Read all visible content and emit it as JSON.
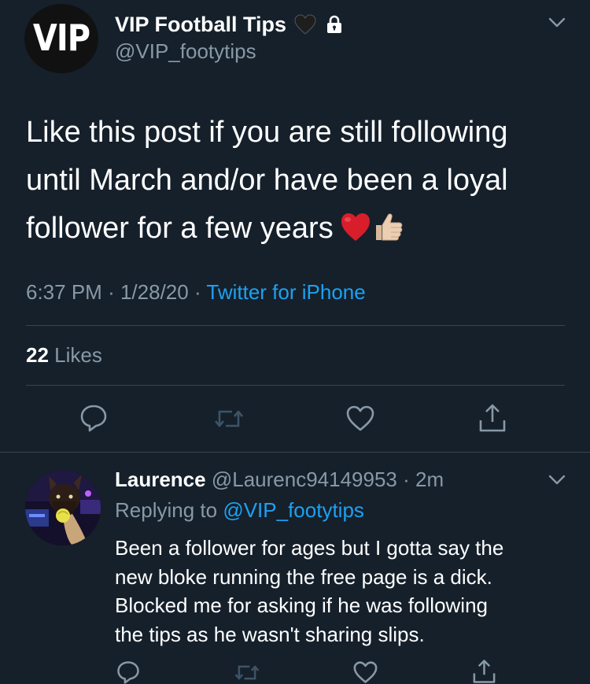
{
  "tweet": {
    "avatar_text": "VIP",
    "display_name": "VIP Football Tips",
    "handle": "@VIP_footytips",
    "text_lines": [
      "Like this post if you are still following",
      "until March and/or have been a loyal",
      "follower for a few years"
    ],
    "time": "6:37 PM",
    "date": "1/28/20",
    "source": "Twitter for iPhone",
    "likes_count": "22",
    "likes_label": "Likes",
    "separator": "·"
  },
  "reply": {
    "display_name": "Laurence",
    "handle": "@Laurenc94149953",
    "age": "2m",
    "replying_prefix": "Replying to",
    "replying_to": "@VIP_footytips",
    "text_lines": [
      "Been a follower for ages but I gotta say the",
      "new bloke running the free page is a dick.",
      "Blocked me for asking if he was following",
      "the tips as he wasn't sharing slips."
    ]
  },
  "icons": {
    "name_badge_1": "black-heart-emoji",
    "name_badge_2": "lock-icon",
    "menu": "chevron-down-icon",
    "text_emoji_1": "red-heart-emoji",
    "text_emoji_2": "thumbs-up-emoji",
    "actions": [
      "reply-icon",
      "retweet-icon",
      "like-icon",
      "share-icon"
    ]
  },
  "colors": {
    "background": "#15202b",
    "text_primary": "#ffffff",
    "text_secondary": "#8899a6",
    "accent": "#1da1f2",
    "divider": "#38444d",
    "retweet_disabled": "#3d5466"
  }
}
